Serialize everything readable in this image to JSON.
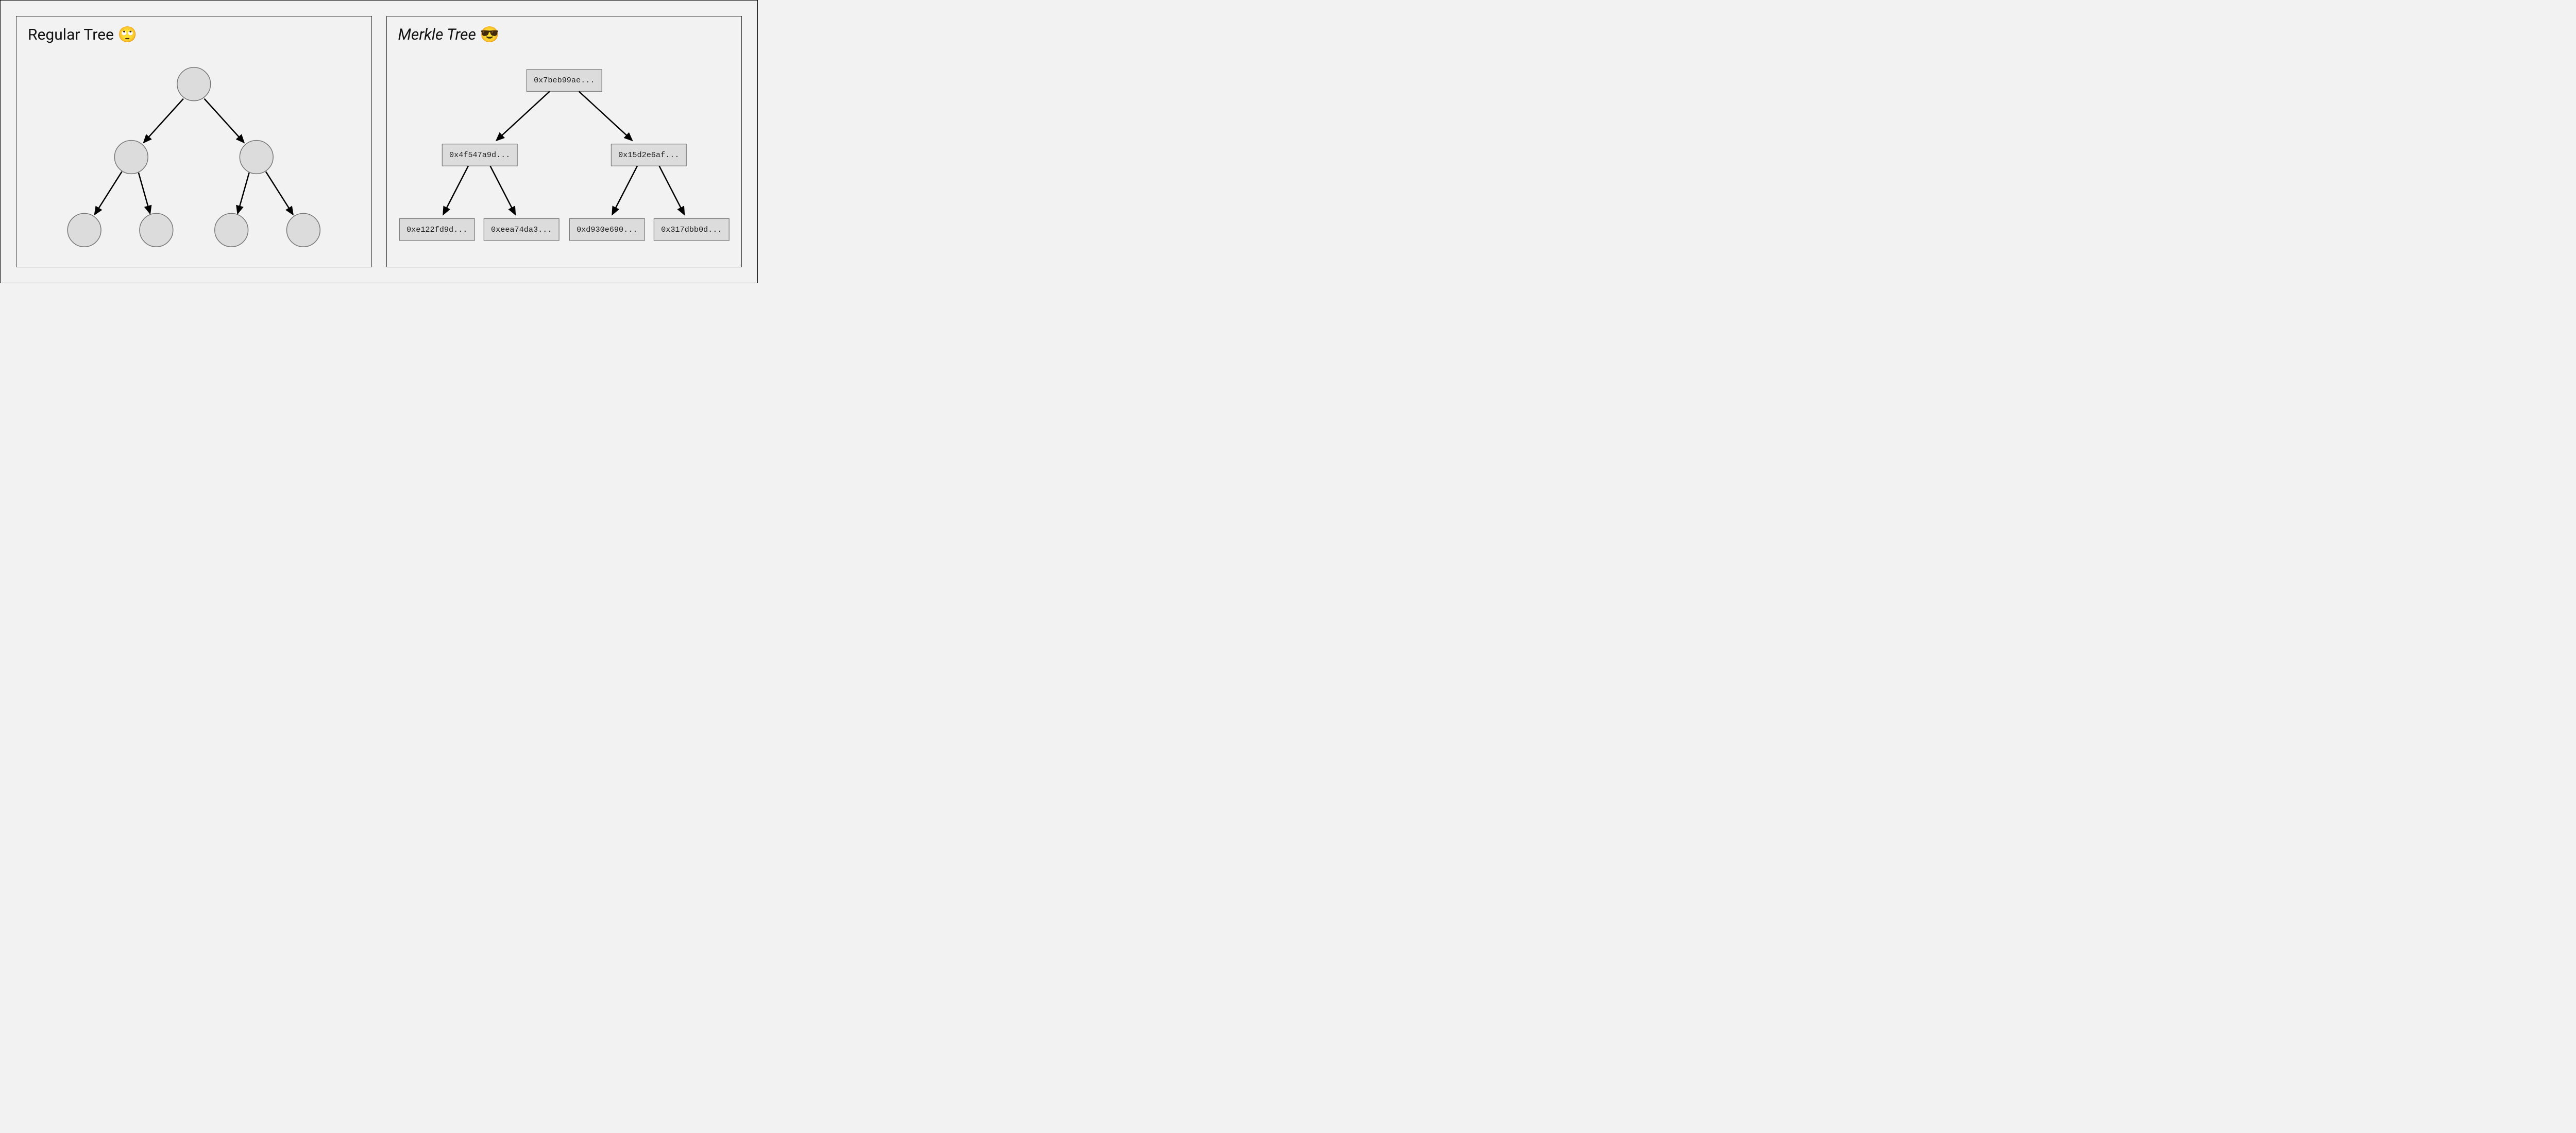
{
  "left": {
    "title": "Regular Tree",
    "emoji": "🙄"
  },
  "right": {
    "title": "Merkle Tree",
    "emoji": "😎",
    "root": "0x7beb99ae...",
    "mid_left": "0x4f547a9d...",
    "mid_right": "0x15d2e6af...",
    "leaf1": "0xe122fd9d...",
    "leaf2": "0xeea74da3...",
    "leaf3": "0xd930e690...",
    "leaf4": "0x317dbb0d..."
  }
}
